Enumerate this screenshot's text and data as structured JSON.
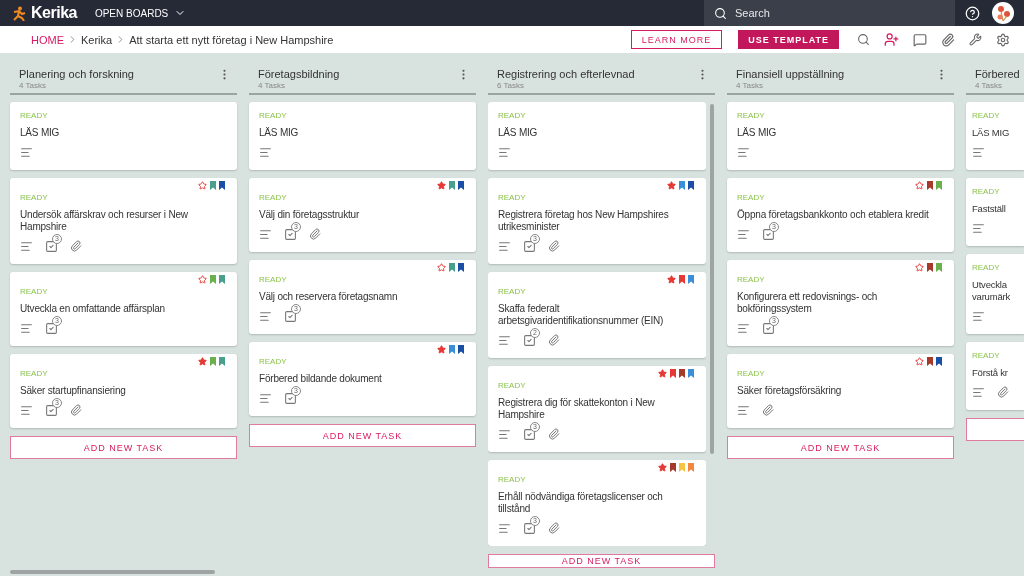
{
  "app": {
    "logo": "Kerika",
    "menu": "OPEN BOARDS"
  },
  "search": {
    "placeholder": "Search"
  },
  "breadcrumb": [
    "HOME",
    "Kerika",
    "Att starta ett nytt företag i New Hampshire"
  ],
  "actions": {
    "learn_more": "LEARN MORE",
    "use_template": "USE TEMPLATE"
  },
  "columns": [
    {
      "title": "Planering och forskning",
      "count": "4 Tasks",
      "add_task": "ADD NEW TASK",
      "truncated": false,
      "cards": [
        {
          "status": "READY",
          "title": "LÄS MIG"
        },
        {
          "status": "READY",
          "title": "Undersök affärskrav och resurser i New Hampshire",
          "starred": false,
          "tags": [
            {
              "color": "#4a9e8e"
            },
            {
              "color": "#1a4fa8"
            }
          ],
          "checklist": "3",
          "attachment": true
        },
        {
          "status": "READY",
          "title": "Utveckla en omfattande affärsplan",
          "starred": false,
          "tags": [
            {
              "color": "#6ab04c"
            },
            {
              "color": "#4a9e8e"
            }
          ],
          "checklist": "3",
          "attachment": false
        },
        {
          "status": "READY",
          "title": "Säker startupfinansiering",
          "starred": true,
          "tags": [
            {
              "color": "#6ab04c"
            },
            {
              "color": "#4a9e8e"
            }
          ],
          "checklist": "3",
          "attachment": true
        }
      ]
    },
    {
      "title": "Företagsbildning",
      "count": "4 Tasks",
      "add_task": "ADD NEW TASK",
      "truncated": false,
      "cards": [
        {
          "status": "READY",
          "title": "LÄS MIG"
        },
        {
          "status": "READY",
          "title": "Välj din företagsstruktur",
          "starred": true,
          "tags": [
            {
              "color": "#4a9e8e"
            },
            {
              "color": "#1a4fa8"
            }
          ],
          "checklist": "3",
          "attachment": true
        },
        {
          "status": "READY",
          "title": "Välj och reservera företagsnamn",
          "starred": false,
          "tags": [
            {
              "color": "#4a9e8e"
            },
            {
              "color": "#1a4fa8"
            }
          ],
          "checklist": "3",
          "attachment": false
        },
        {
          "status": "READY",
          "title": "Förbered bildande dokument",
          "starred": true,
          "tags": [
            {
              "color": "#3a8fd8"
            },
            {
              "color": "#1a4fa8"
            }
          ],
          "checklist": "3",
          "attachment": false
        }
      ]
    },
    {
      "title": "Registrering och efterlevnad",
      "count": "6 Tasks",
      "add_task": "ADD NEW TASK",
      "truncated": false,
      "scrolling": true,
      "cards": [
        {
          "status": "READY",
          "title": "LÄS MIG"
        },
        {
          "status": "READY",
          "title": "Registrera företag hos New Hampshires utrikesminister",
          "starred": true,
          "tags": [
            {
              "color": "#3a8fd8"
            },
            {
              "color": "#1a4fa8"
            }
          ],
          "checklist": "3",
          "attachment": true
        },
        {
          "status": "READY",
          "title": "Skaffa federalt arbetsgivaridentifikationsnummer (EIN)",
          "starred": true,
          "tags": [
            {
              "color": "#e53935"
            },
            {
              "color": "#3a8fd8"
            }
          ],
          "checklist": "2",
          "attachment": true
        },
        {
          "status": "READY",
          "title": "Registrera dig för skattekonton i New Hampshire",
          "starred": true,
          "tags": [
            {
              "color": "#e53935"
            },
            {
              "color": "#a63a2a"
            },
            {
              "color": "#3a8fd8"
            }
          ],
          "checklist": "3",
          "attachment": true
        },
        {
          "status": "READY",
          "title": "Erhåll nödvändiga företagslicenser och tillstånd",
          "starred": true,
          "tags": [
            {
              "color": "#a63a2a"
            },
            {
              "color": "#f5c542"
            },
            {
              "color": "#f0883e"
            }
          ],
          "checklist": "3",
          "attachment": true
        }
      ]
    },
    {
      "title": "Finansiell uppställning",
      "count": "4 Tasks",
      "add_task": "ADD NEW TASK",
      "truncated": false,
      "cards": [
        {
          "status": "READY",
          "title": "LÄS MIG"
        },
        {
          "status": "READY",
          "title": "Öppna företagsbankkonto och etablera kredit",
          "starred": false,
          "tags": [
            {
              "color": "#a63a2a"
            },
            {
              "color": "#6ab04c"
            }
          ],
          "checklist": "3",
          "attachment": false
        },
        {
          "status": "READY",
          "title": "Konfigurera ett redovisnings- och bokföringssystem",
          "starred": false,
          "tags": [
            {
              "color": "#a63a2a"
            },
            {
              "color": "#6ab04c"
            }
          ],
          "checklist": "3",
          "attachment": false
        },
        {
          "status": "READY",
          "title": "Säker företagsförsäkring",
          "starred": false,
          "tags": [
            {
              "color": "#a63a2a"
            },
            {
              "color": "#1a4fa8"
            }
          ],
          "attachment": true
        }
      ]
    },
    {
      "title": "Förbered",
      "count": "4 Tasks",
      "truncated": true,
      "cards": [
        {
          "status": "READY",
          "title": "LÄS MIG"
        },
        {
          "status": "READY",
          "title": "Fastställ",
          "attachment": false
        },
        {
          "status": "READY",
          "title": "Utveckla\nvarumärk",
          "attachment": false
        },
        {
          "status": "READY",
          "title": "Förstå kr",
          "attachment": true
        }
      ]
    }
  ]
}
